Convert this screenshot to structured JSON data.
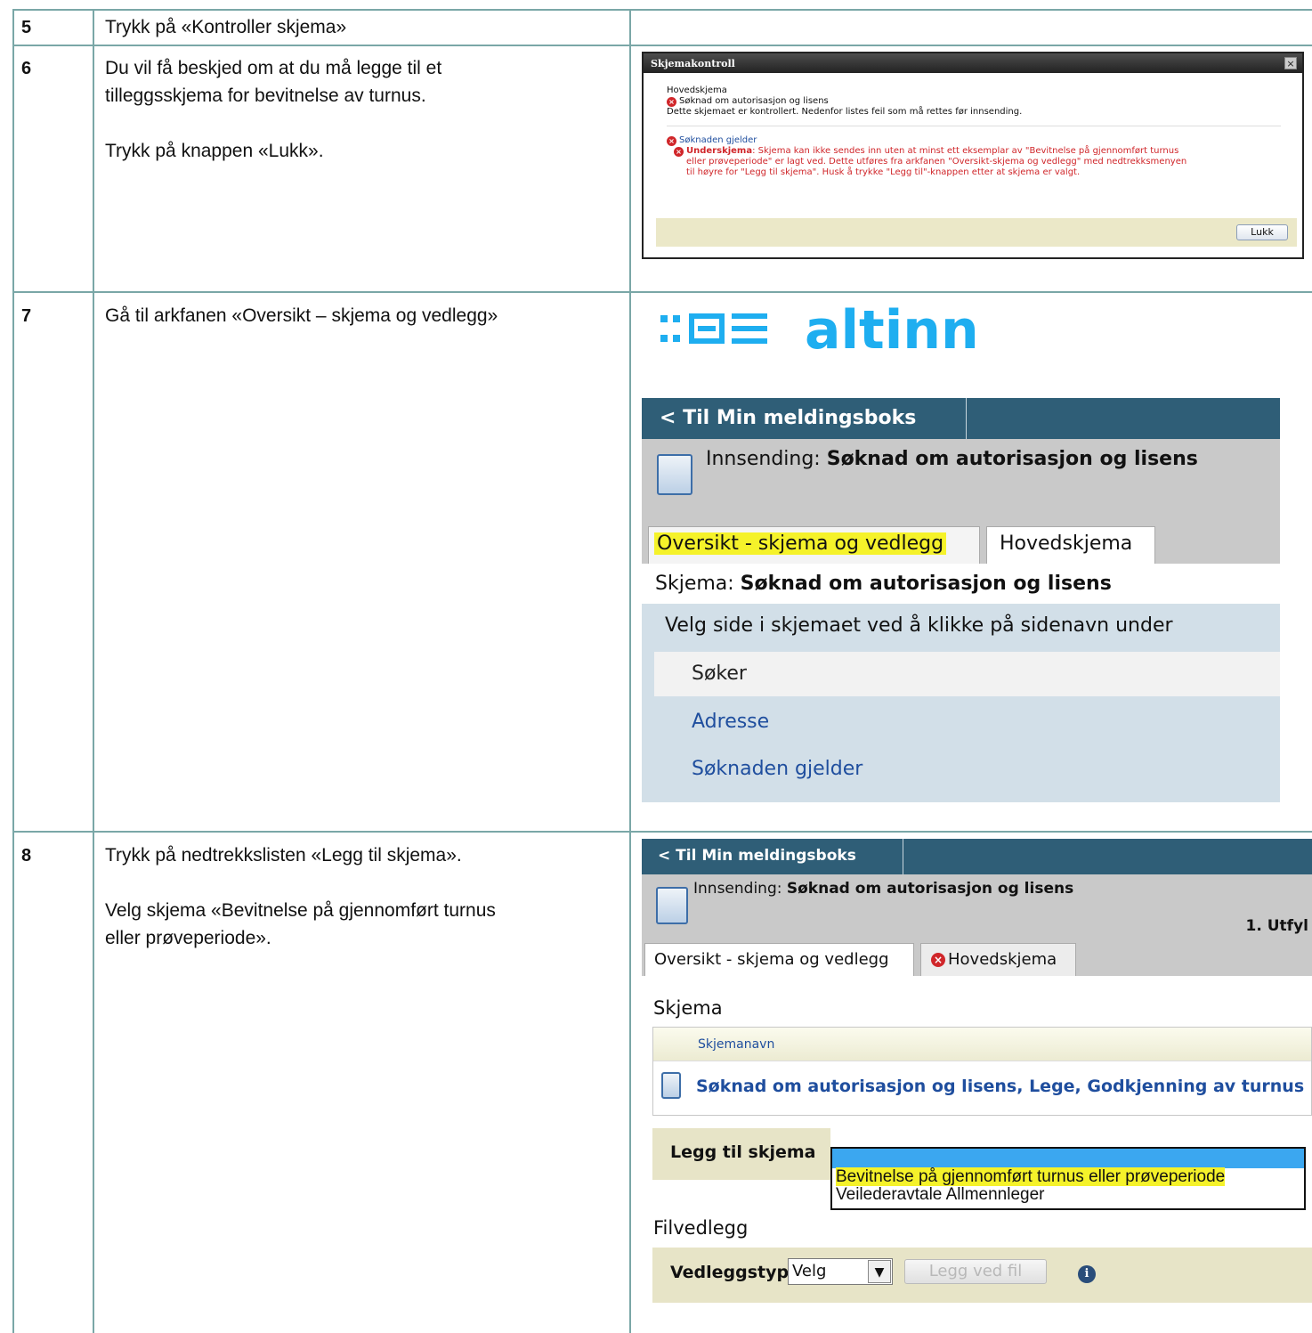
{
  "rows": [
    {
      "num": "5",
      "text": [
        "Trykk på «Kontroller skjema»"
      ]
    },
    {
      "num": "6",
      "text": [
        "Du vil få beskjed om at du må legge til et",
        "tilleggsskjema for bevitnelse av turnus.",
        "",
        "Trykk på knappen «Lukk»."
      ]
    },
    {
      "num": "7",
      "text": [
        "Gå til arkfanen «Oversikt – skjema og vedlegg»"
      ]
    },
    {
      "num": "8",
      "text": [
        "Trykk på nedtrekkslisten «Legg til skjema».",
        "",
        "Velg skjema «Bevitnelse på gjennomført turnus",
        "eller prøveperiode»."
      ]
    }
  ],
  "dialog": {
    "title": "Skjemakontroll",
    "close": "×",
    "section": "Hovedskjema",
    "form_name": "Søknad om autorisasjon og lisens",
    "controlled_msg": "Dette skjemaet er kontrollert. Nedenfor listes feil som må rettes før innsending.",
    "group": "Søknaden gjelder",
    "error_label": "Underskjema",
    "error_lines": [
      ": Skjema kan ikke sendes inn uten at minst ett eksemplar av \"Bevitnelse på gjennomført turnus",
      "eller prøveperiode\" er lagt ved. Dette utføres fra arkfanen \"Oversikt-skjema og vedlegg\" med nedtrekksmenyen",
      "til høyre for \"Legg til skjema\". Husk å trykke \"Legg til\"-knappen etter at skjema er valgt."
    ],
    "button": "Lukk"
  },
  "altinn": {
    "logo_text": "altinn",
    "back": "< Til Min meldingsboks",
    "submission_prefix": "Innsending: ",
    "submission_name": "Søknad om autorisasjon og lisens",
    "tab_overview": "Oversikt - skjema og vedlegg",
    "tab_main": "Hovedskjema",
    "form_prefix": "Skjema: ",
    "form_name": "Søknad om autorisasjon og lisens",
    "side_header": "Velg side i skjemaet ved å klikke på sidenavn under",
    "pages": [
      "Søker",
      "Adresse",
      "Søknaden gjelder"
    ]
  },
  "altinn2": {
    "back": "< Til Min meldingsboks",
    "submission_prefix": "Innsending: ",
    "submission_name": "Søknad om autorisasjon og lisens",
    "step": "1. Utfyl",
    "tab_overview": "Oversikt - skjema og vedlegg",
    "tab_main": "Hovedskjema",
    "section_forms": "Skjema",
    "col_header": "Skjemanavn",
    "form_link": "Søknad om autorisasjon og lisens, Lege, Godkjenning av turnus",
    "add_form_label": "Legg til skjema",
    "options": [
      "Bevitnelse på gjennomført turnus eller prøveperiode",
      "Veilederavtale Allmennleger"
    ],
    "section_files": "Filvedlegg",
    "attachment_type_label": "Vedleggstype:",
    "select_value": "Velg",
    "attach_button": "Legg ved fil",
    "info_glyph": "i"
  },
  "colors": {
    "navbar": "#2f5e77",
    "highlight": "#f5f22a",
    "altinn_blue": "#1eaef0",
    "error_red": "#d0262a"
  }
}
